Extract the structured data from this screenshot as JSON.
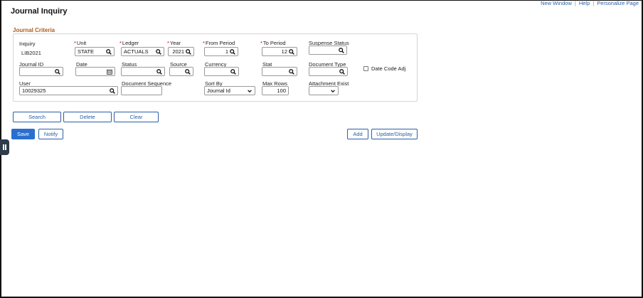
{
  "header": {
    "title": "Journal Inquiry",
    "links": [
      "New Window",
      "Help",
      "Personalize Page"
    ]
  },
  "criteria": {
    "title": "Journal Criteria",
    "inquiry": {
      "label": "Inquiry",
      "value": "LIB2021"
    },
    "unit": {
      "label": "Unit",
      "value": "STATE"
    },
    "ledger": {
      "label": "Ledger",
      "value": "ACTUALS"
    },
    "year": {
      "label": "Year",
      "value": "2021"
    },
    "from_period": {
      "label": "From Period",
      "value": "1"
    },
    "to_period": {
      "label": "To Period",
      "value": "12"
    },
    "suspense_status": {
      "label": "Suspense Status",
      "value": ""
    },
    "journal_id": {
      "label": "Journal ID",
      "value": ""
    },
    "date": {
      "label": "Date",
      "value": ""
    },
    "status": {
      "label": "Status",
      "value": ""
    },
    "source": {
      "label": "Source",
      "value": ""
    },
    "currency": {
      "label": "Currency",
      "value": ""
    },
    "stat": {
      "label": "Stat",
      "value": ""
    },
    "document_type": {
      "label": "Document Type",
      "value": ""
    },
    "date_code_adj": {
      "label": "Date Code Adj",
      "checked": false
    },
    "user": {
      "label": "User",
      "value": "10029325"
    },
    "document_sequence": {
      "label": "Document Sequence",
      "value": ""
    },
    "sort_by": {
      "label": "Sort By",
      "value": "Journal Id"
    },
    "max_rows": {
      "label": "Max Rows",
      "value": "100"
    },
    "attachment_exist": {
      "label": "Attachment Exist",
      "value": ""
    }
  },
  "actions": {
    "search": "Search",
    "delete": "Delete",
    "clear": "Clear"
  },
  "footer": {
    "save": "Save",
    "notify": "Notify",
    "add": "Add",
    "update_display": "Update/Display"
  },
  "colors": {
    "accent": "#2a5fa8",
    "primary_button": "#2a6fcf",
    "section_title": "#b05a1c",
    "required": "#bb0000"
  }
}
